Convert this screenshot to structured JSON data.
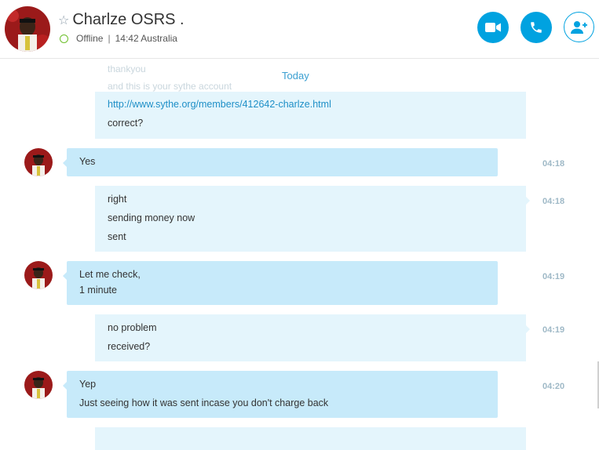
{
  "header": {
    "contact_name": "Charlze OSRS .",
    "status": "Offline",
    "local_time": "14:42 Australia",
    "star_icon": "star-outline-icon",
    "video_icon": "video-camera-icon",
    "call_icon": "phone-icon",
    "add_icon": "add-person-icon",
    "accent_color": "#00a2e0"
  },
  "chat": {
    "date_separator": "Today",
    "ghost_lines": [
      "thankyou",
      "and this is your sythe account"
    ],
    "messages": [
      {
        "sender": "me",
        "lines": [
          "http://www.sythe.org/members/412642-charlze.html",
          "correct?"
        ],
        "time": ""
      },
      {
        "sender": "them",
        "lines": [
          "Yes"
        ],
        "time": "04:18"
      },
      {
        "sender": "me",
        "lines": [
          "right",
          "sending money now",
          "sent"
        ],
        "time": "04:18"
      },
      {
        "sender": "them",
        "lines": [
          "Let me check,",
          "1 minute"
        ],
        "time": "04:19"
      },
      {
        "sender": "me",
        "lines": [
          "no problem",
          "received?"
        ],
        "time": "04:19"
      },
      {
        "sender": "them",
        "lines": [
          "Yep",
          "Just seeing how it was sent incase you don't charge back"
        ],
        "time": "04:20"
      }
    ]
  }
}
